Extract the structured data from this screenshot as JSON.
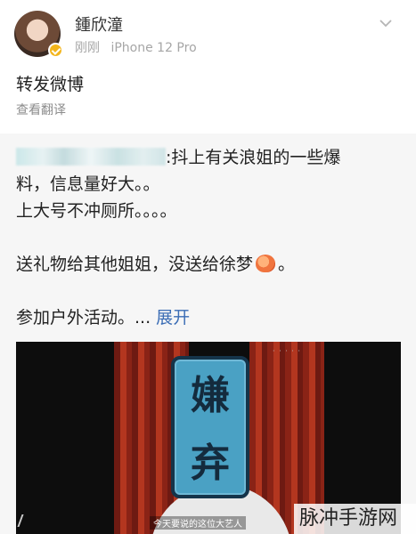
{
  "header": {
    "username": "鍾欣潼",
    "time": "刚刚",
    "device": "iPhone 12 Pro",
    "avatar_icon": "user-avatar",
    "verified_icon": "verified-badge-icon",
    "menu_icon": "chevron-down-icon"
  },
  "post": {
    "text": "转发微博",
    "translate_label": "查看翻译"
  },
  "repost": {
    "lines": [
      ":抖上有关浪姐的一些爆",
      "料，信息量好大。。",
      "上大号不冲厕所。。。。",
      "",
      "送礼物给其他姐姐，没送给徐梦",
      "。",
      "",
      "参加户外活动。..."
    ],
    "expand_label": "展开",
    "emoji_icon": "peach-emoji-icon"
  },
  "video": {
    "stamp_text": [
      "嫌",
      "弃"
    ],
    "subtitle": "今天要说的这位大艺人"
  },
  "watermark": "脉冲手游网",
  "colors": {
    "link": "#3b6db5",
    "meta": "#a6a6a6",
    "repost_bg": "#f6f6f6",
    "verified": "#f3b51b",
    "stamp": "#4aa1c4"
  }
}
